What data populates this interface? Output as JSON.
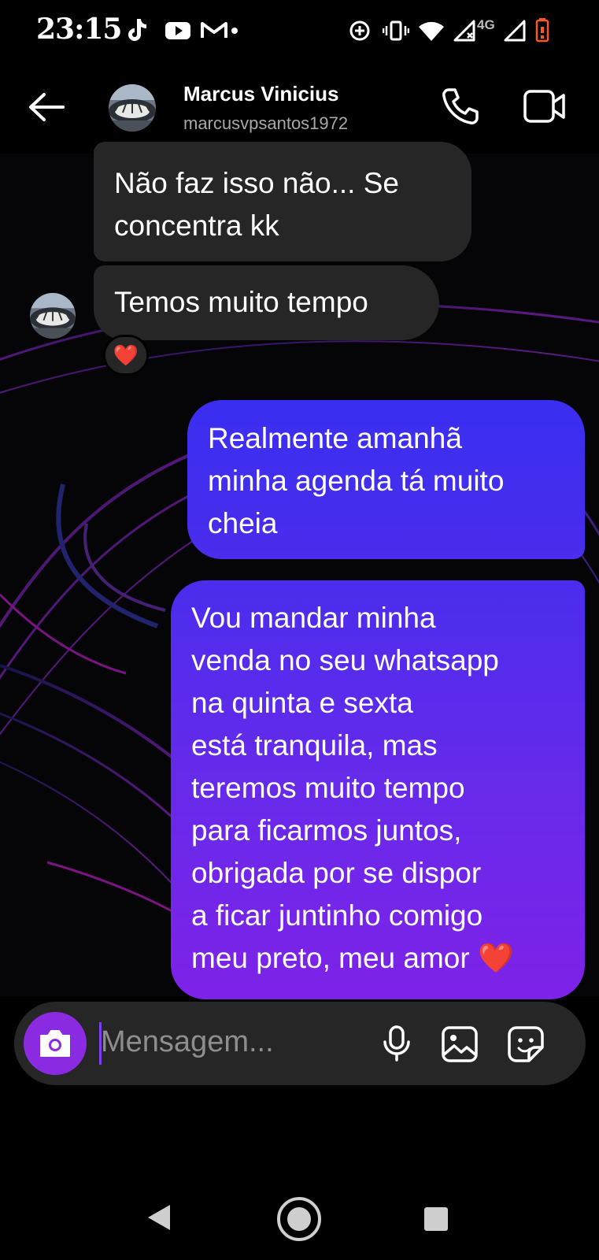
{
  "status_bar": {
    "time": "23:15",
    "network": "4G"
  },
  "header": {
    "name": "Marcus Vinicius",
    "username": "marcusvpsantos1972"
  },
  "messages": [
    {
      "from": "them",
      "lines": [
        "Não faz isso não... Se",
        "concentra kk"
      ]
    },
    {
      "from": "them",
      "lines": [
        "Temos muito tempo"
      ],
      "reaction": "❤️"
    },
    {
      "from": "me",
      "lines": [
        "Realmente amanhã",
        "minha agenda tá muito",
        "cheia"
      ]
    },
    {
      "from": "me",
      "lines": [
        "Vou mandar minha",
        "venda no seu whatsapp",
        "na quinta e sexta",
        "está tranquila, mas",
        "teremos muito tempo",
        "para ficarmos juntos,",
        "obrigada por se dispor",
        "a ficar juntinho comigo",
        "meu preto, meu amor ❤️"
      ]
    }
  ],
  "composer": {
    "placeholder": "Mensagem..."
  },
  "colors": {
    "accent": "#8a2be2",
    "sent_top": "#3a2ef0",
    "sent_bottom": "#7e22e8",
    "received": "#262626"
  }
}
